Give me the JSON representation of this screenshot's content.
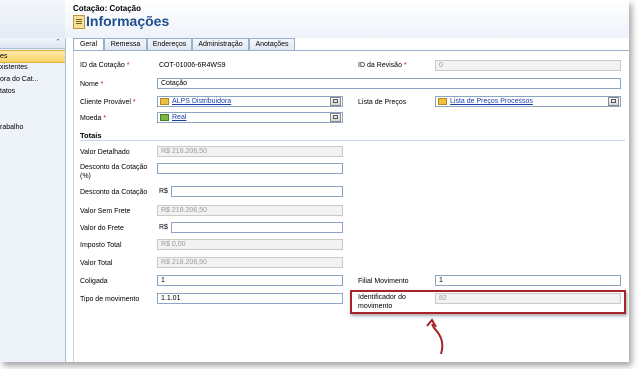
{
  "header": {
    "breadcrumb": "Cotação: Cotação",
    "title": "Informações"
  },
  "sidebar": {
    "items": [
      {
        "label": "es",
        "active": true
      },
      {
        "label": "xistentes",
        "active": false
      },
      {
        "label": "ora do Cat...",
        "active": false
      },
      {
        "label": "tatos",
        "active": false
      },
      {
        "label": "rabalho",
        "active": false
      }
    ]
  },
  "tabs": [
    "Geral",
    "Remessa",
    "Endereços",
    "Administração",
    "Anotações"
  ],
  "form": {
    "id_cotacao_label": "ID da Cotação",
    "id_cotacao_value": "COT-01006-6R4WS9",
    "id_revisao_label": "ID da Revisão",
    "id_revisao_value": "0",
    "nome_label": "Nome",
    "nome_value": "Cotação",
    "cliente_label": "Cliente Provável",
    "cliente_value": "ALPS Distribuidora",
    "lista_precos_label": "Lista de Preços",
    "lista_precos_value": "Lista de Preços Processos",
    "moeda_label": "Moeda",
    "moeda_value": "Real",
    "required_marker": "*"
  },
  "totais": {
    "section_title": "Totais",
    "currency": "R$",
    "valor_detalhado_label": "Valor Detalhado",
    "valor_detalhado_value": "218.206,50",
    "desconto_pct_label": "Desconto da Cotação (%)",
    "desconto_pct_value": "",
    "desconto_label": "Desconto da Cotação",
    "desconto_value": "",
    "valor_sem_frete_label": "Valor Sem Frete",
    "valor_sem_frete_value": "218.206,50",
    "valor_frete_label": "Valor do Frete",
    "valor_frete_value": "",
    "imposto_label": "Imposto Total",
    "imposto_value": "0,00",
    "valor_total_label": "Valor Total",
    "valor_total_value": "218.206,50",
    "coligada_label": "Coligada",
    "coligada_value": "1",
    "filial_label": "Filial Movimento",
    "filial_value": "1",
    "tipo_mov_label": "Tipo de movimento",
    "tipo_mov_value": "1.1.01",
    "identificador_label": "Identificador do movimento",
    "identificador_value": "82"
  },
  "colors": {
    "title": "#1f4e8c",
    "link": "#1a3ea8",
    "required": "#d00000",
    "highlight_border": "#a8222a"
  }
}
